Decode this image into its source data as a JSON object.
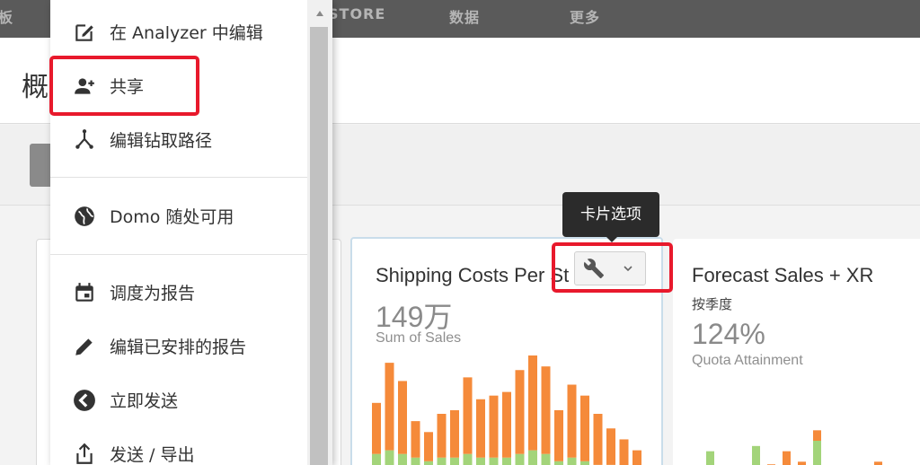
{
  "nav": {
    "items": [
      {
        "label": "STORE",
        "left": 365
      },
      {
        "label": "数据",
        "left": 500
      },
      {
        "label": "更多",
        "left": 634
      }
    ],
    "partial_left": "板"
  },
  "page": {
    "title": "概"
  },
  "menu": {
    "items": [
      {
        "label": "在 Analyzer 中编辑",
        "icon": "edit-square-icon"
      },
      {
        "label": "共享",
        "icon": "add-person-icon"
      },
      {
        "label": "编辑钻取路径",
        "icon": "drill-path-icon"
      },
      {
        "label": "Domo 随处可用",
        "icon": "globe-icon"
      },
      {
        "label": "调度为报告",
        "icon": "calendar-icon"
      },
      {
        "label": "编辑已安排的报告",
        "icon": "pencil-icon"
      },
      {
        "label": "立即发送",
        "icon": "send-icon"
      },
      {
        "label": "发送 / 导出",
        "icon": "share-export-icon"
      }
    ]
  },
  "tooltip": {
    "text": "卡片选项"
  },
  "cards": {
    "shipping": {
      "title": "Shipping Costs Per St",
      "value": "149万",
      "metric": "Sum of Sales"
    },
    "forecast": {
      "title": "Forecast Sales + XR",
      "subtitle": "按季度",
      "value": "124%",
      "metric": "Quota Attainment"
    }
  },
  "colors": {
    "orange": "#f58a3a",
    "green": "#a3d47a",
    "highlight": "#e8192c",
    "nav_bg": "#5a5a5a"
  },
  "chart_data": [
    {
      "type": "bar",
      "series": [
        {
          "values": [
            14,
            24,
            20,
            10,
            8,
            12,
            13,
            21,
            16,
            17,
            18,
            23,
            30,
            24,
            14,
            20,
            18,
            14,
            10,
            8,
            6
          ]
        },
        {
          "values": [
            5,
            6,
            5,
            4,
            3,
            4,
            4,
            5,
            4,
            4,
            4,
            5,
            6,
            5,
            3,
            4,
            3,
            2,
            2,
            1,
            0
          ]
        }
      ],
      "ylim": [
        0,
        32
      ]
    },
    {
      "type": "bar",
      "series": [
        {
          "values": [
            0,
            0,
            0,
            0,
            0,
            1.5,
            4,
            2,
            2,
            0,
            0,
            0,
            2,
            0,
            0,
            2
          ]
        },
        {
          "values": [
            0,
            4,
            0,
            0,
            5,
            0,
            0,
            0,
            6,
            0,
            0,
            0,
            0,
            0,
            0,
            0
          ]
        }
      ],
      "ylim": [
        0,
        12
      ]
    }
  ]
}
